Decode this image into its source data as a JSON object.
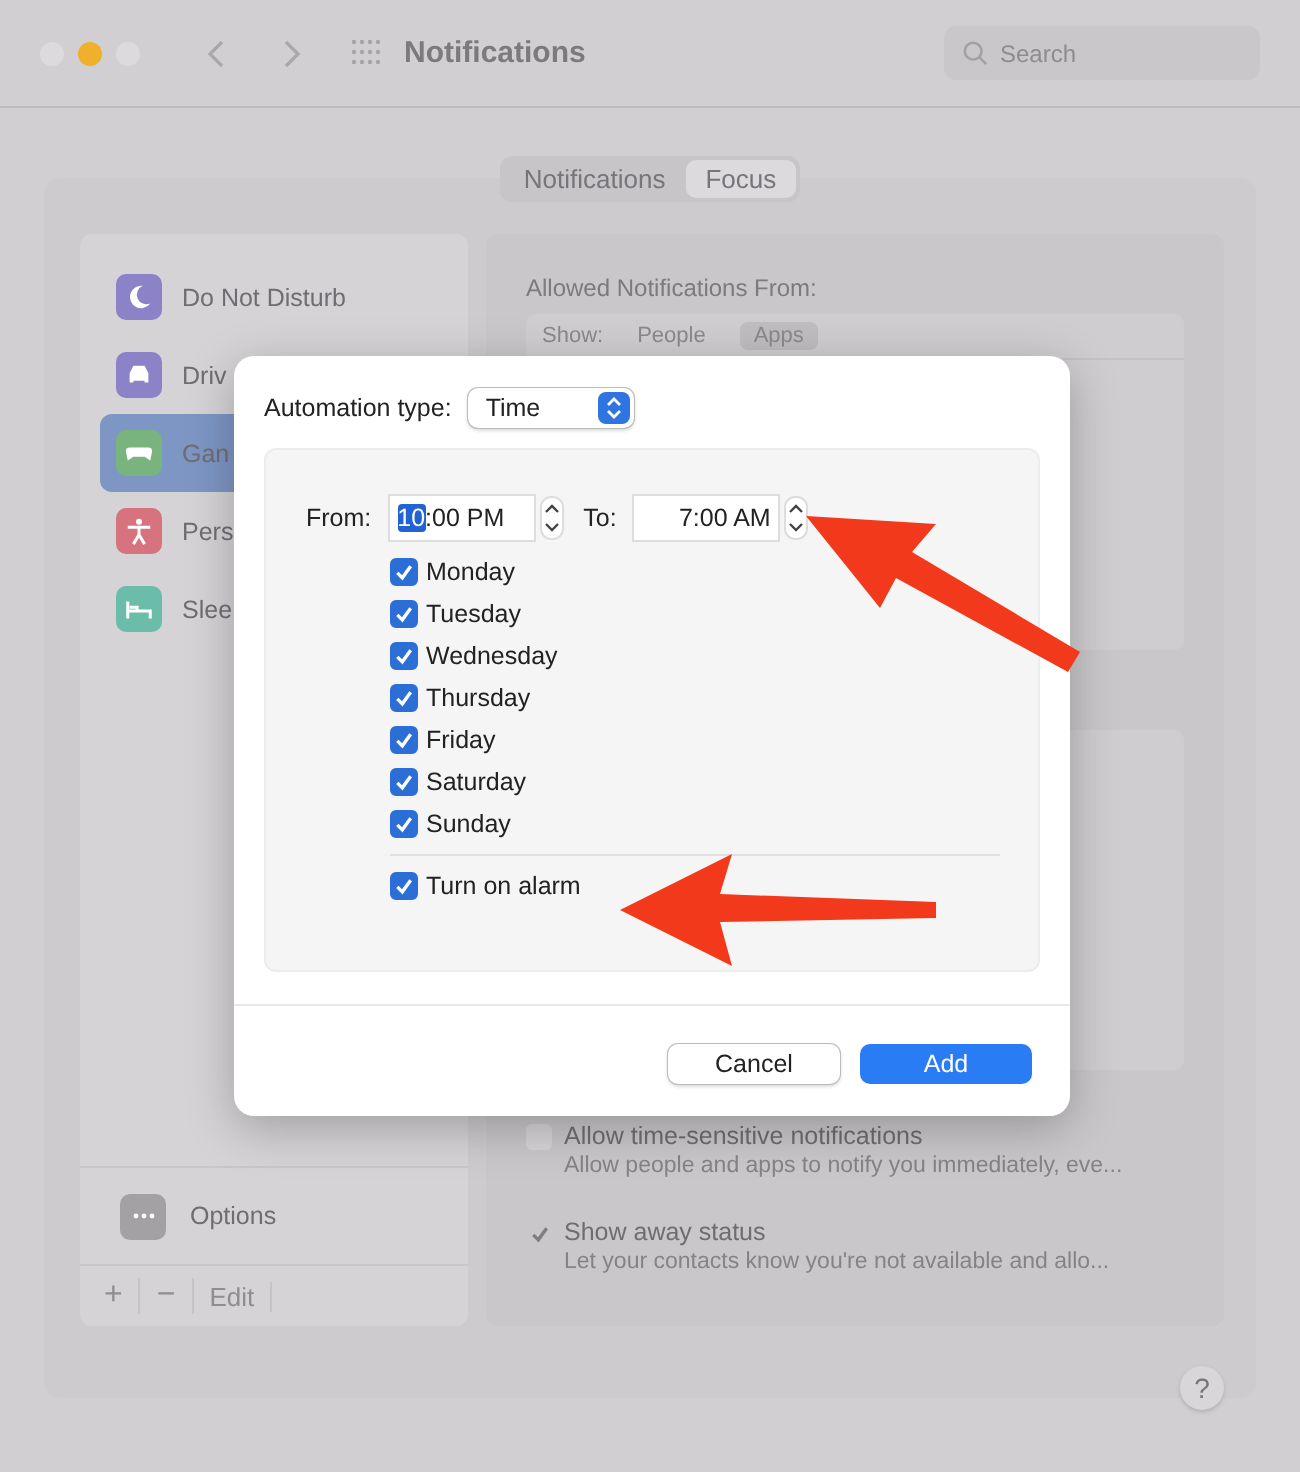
{
  "window": {
    "title": "Notifications",
    "search": {
      "placeholder": "Search"
    }
  },
  "tabs": [
    {
      "label": "Notifications",
      "selected": false
    },
    {
      "label": "Focus",
      "selected": true
    }
  ],
  "sidebar": {
    "items": [
      {
        "label": "Do Not Disturb",
        "kind": "moon",
        "color": "#8b82c8",
        "selected": false
      },
      {
        "label": "Driv",
        "kind": "car",
        "color": "#8b82c8",
        "selected": false
      },
      {
        "label": "Gan",
        "kind": "gamepad",
        "color": "#79b47f",
        "selected": true
      },
      {
        "label": "Pers",
        "kind": "person",
        "color": "#d7737f",
        "selected": false
      },
      {
        "label": "Slee",
        "kind": "bed",
        "color": "#6cbcaa",
        "selected": false
      }
    ],
    "options": {
      "label": "Options"
    },
    "footer": [
      "+",
      "−",
      "Edit"
    ]
  },
  "content": {
    "heading": "Allowed Notifications From:",
    "show_label": "Show:",
    "show_options": [
      {
        "label": "People",
        "selected": false
      },
      {
        "label": "Apps",
        "selected": true
      }
    ],
    "settings": [
      {
        "label": "Allow time-sensitive notifications",
        "description": "Allow people and apps to notify you immediately, eve...",
        "checked": false
      },
      {
        "label": "Show away status",
        "description": "Let your contacts know you're not available and allo...",
        "checked": true
      }
    ],
    "help": "?"
  },
  "dialog": {
    "automation_label": "Automation type:",
    "automation_value": "Time",
    "from_label": "From:",
    "from_hour": "10",
    "from_rest": ":00 PM",
    "to_label": "To:",
    "to_value": "7:00 AM",
    "days": [
      {
        "label": "Monday",
        "checked": true
      },
      {
        "label": "Tuesday",
        "checked": true
      },
      {
        "label": "Wednesday",
        "checked": true
      },
      {
        "label": "Thursday",
        "checked": true
      },
      {
        "label": "Friday",
        "checked": true
      },
      {
        "label": "Saturday",
        "checked": true
      },
      {
        "label": "Sunday",
        "checked": true
      }
    ],
    "alarm": {
      "label": "Turn on alarm",
      "checked": true
    },
    "buttons": [
      {
        "label": "Cancel",
        "kind": "secondary"
      },
      {
        "label": "Add",
        "kind": "primary"
      }
    ]
  }
}
